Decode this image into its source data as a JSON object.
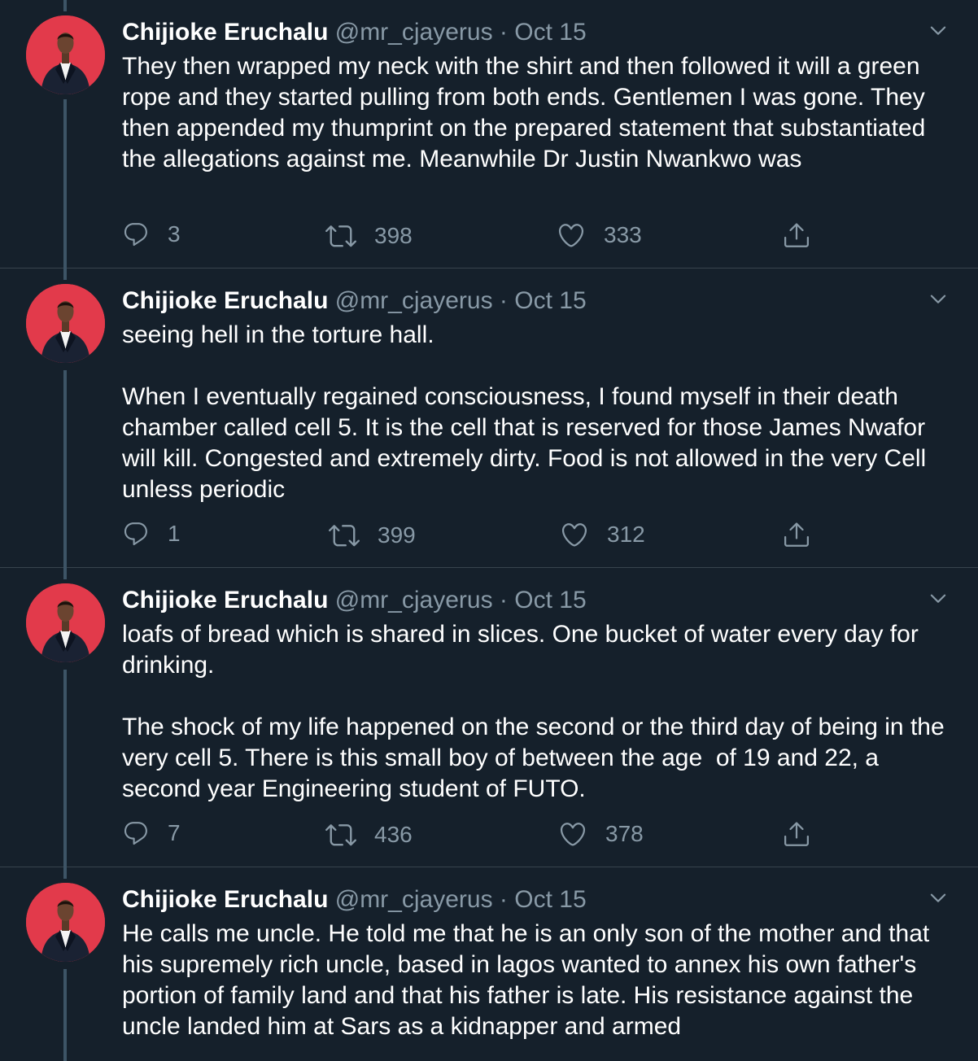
{
  "tweets": [
    {
      "name": "Chijioke Eruchalu",
      "handle": "@mr_cjayerus",
      "separator": "·",
      "date": "Oct 15",
      "text": "They then wrapped my neck with the shirt and then followed it will a green rope and they started pulling from both ends. Gentlemen I was gone. They then appended my thumprint on the prepared statement that substantiated the allegations against me. Meanwhile Dr Justin Nwankwo was",
      "replies": "3",
      "retweets": "398",
      "likes": "333"
    },
    {
      "name": "Chijioke Eruchalu",
      "handle": "@mr_cjayerus",
      "separator": "·",
      "date": "Oct 15",
      "text": "seeing hell in the torture hall.\n\nWhen I eventually regained consciousness, I found myself in their death chamber called cell 5. It is the cell that is reserved for those James Nwafor will kill. Congested and extremely dirty. Food is not allowed in the very Cell unless periodic",
      "replies": "1",
      "retweets": "399",
      "likes": "312"
    },
    {
      "name": "Chijioke Eruchalu",
      "handle": "@mr_cjayerus",
      "separator": "·",
      "date": "Oct 15",
      "text": "loafs of bread which is shared in slices. One bucket of water every day for drinking.\n\nThe shock of my life happened on the second or the third day of being in the very cell 5. There is this small boy of between the age  of 19 and 22, a second year Engineering student of FUTO.",
      "replies": "7",
      "retweets": "436",
      "likes": "378"
    },
    {
      "name": "Chijioke Eruchalu",
      "handle": "@mr_cjayerus",
      "separator": "·",
      "date": "Oct 15",
      "text": "He calls me uncle. He told me that he is an only son of the mother and that his supremely rich uncle, based in lagos wanted to annex his own father's portion of family land and that his father is late. His resistance against the uncle landed him at Sars as a kidnapper and armed"
    }
  ],
  "icons": {
    "reply": "reply-icon",
    "retweet": "retweet-icon",
    "like": "heart-icon",
    "share": "share-icon",
    "more": "chevron-down-icon"
  },
  "colors": {
    "background": "#15202b",
    "secondary_text": "#8899a6",
    "avatar_bg": "#e23a4b",
    "thread_line": "#3d5466"
  }
}
